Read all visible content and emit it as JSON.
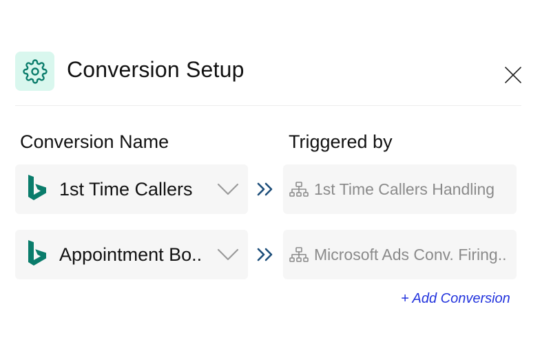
{
  "header": {
    "title": "Conversion Setup",
    "icon": "gear-icon",
    "close_icon": "close-icon"
  },
  "columns": {
    "name_header": "Conversion Name",
    "triggered_header": "Triggered by"
  },
  "rows": [
    {
      "platform_icon": "bing-icon",
      "name": "1st Time Callers",
      "triggered_by": "1st Time Callers Handling"
    },
    {
      "platform_icon": "bing-icon",
      "name": "Appointment Bo..",
      "triggered_by": "Microsoft Ads Conv. Firing.."
    }
  ],
  "add_conversion_label": "+ Add Conversion",
  "colors": {
    "accent_teal": "#0a7c6b",
    "icon_bg": "#d9f7ee",
    "arrow_navy": "#1d4e7a",
    "link_blue": "#2233dd",
    "field_bg": "#f6f6f6",
    "muted_text": "#8a8a8a"
  }
}
